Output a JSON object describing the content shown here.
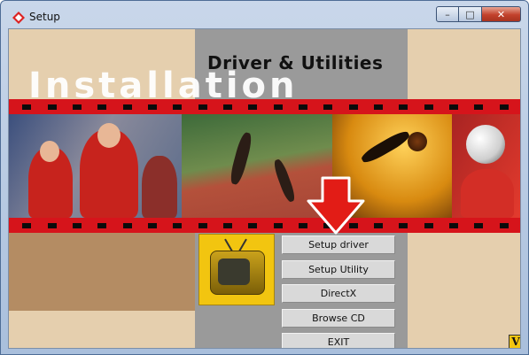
{
  "window": {
    "title": "Setup",
    "controls": {
      "minimize": "–",
      "maximize": "□",
      "close": "✕"
    }
  },
  "banner": {
    "heading": "Driver & Utilities",
    "subheading": "Installation"
  },
  "menu": [
    {
      "label": "Setup driver"
    },
    {
      "label": "Setup Utility"
    },
    {
      "label": "DirectX"
    },
    {
      "label": "Browse CD"
    },
    {
      "label": "EXIT"
    }
  ],
  "icons": {
    "app": "setup-app-icon",
    "arrow": "red-down-arrow",
    "tv": "yellow-tv",
    "logo": "v-logo"
  },
  "colors": {
    "film_strip": "#d6141b",
    "background": "#e5cfae",
    "center_panel": "#9a9a9a",
    "button": "#d9d9d9"
  }
}
